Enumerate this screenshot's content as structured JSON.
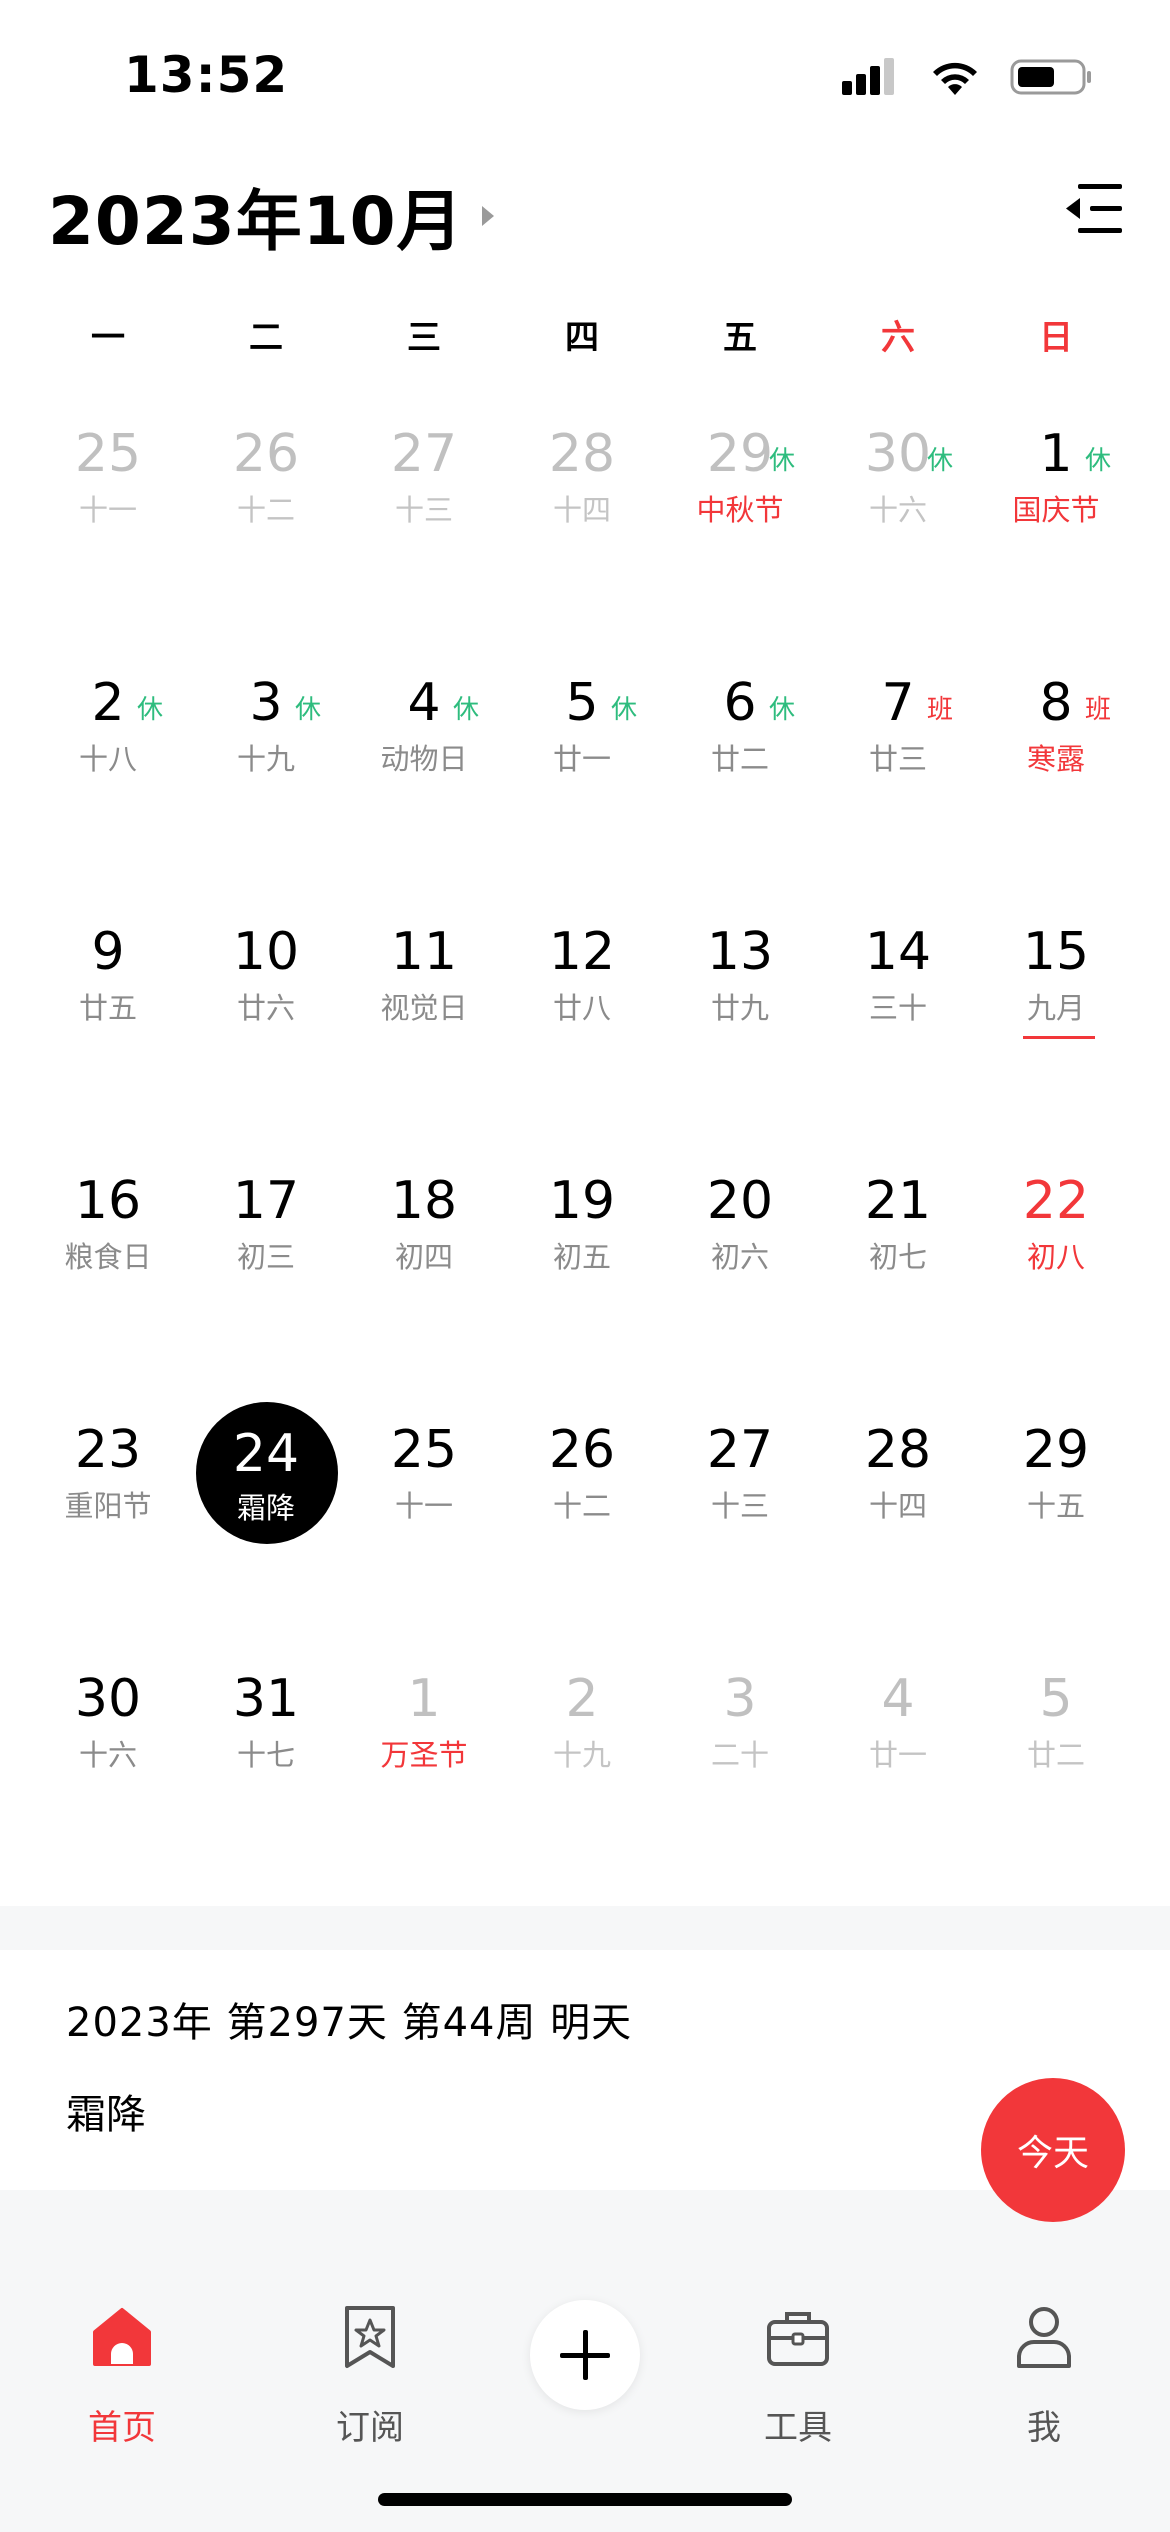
{
  "status": {
    "time": "13:52"
  },
  "header": {
    "month_title": "2023年10月"
  },
  "weekdays": [
    {
      "label": "一",
      "red": false
    },
    {
      "label": "二",
      "red": false
    },
    {
      "label": "三",
      "red": false
    },
    {
      "label": "四",
      "red": false
    },
    {
      "label": "五",
      "red": false
    },
    {
      "label": "六",
      "red": true
    },
    {
      "label": "日",
      "red": true
    }
  ],
  "weeks": [
    [
      {
        "day": "25",
        "lunar": "十一",
        "dim": true
      },
      {
        "day": "26",
        "lunar": "十二",
        "dim": true
      },
      {
        "day": "27",
        "lunar": "十三",
        "dim": true
      },
      {
        "day": "28",
        "lunar": "十四",
        "dim": true
      },
      {
        "day": "29",
        "lunar": "中秋节",
        "dim": true,
        "lunar_red": true,
        "badge": "休"
      },
      {
        "day": "30",
        "lunar": "十六",
        "dim": true,
        "badge": "休"
      },
      {
        "day": "1",
        "lunar": "国庆节",
        "lunar_red": true,
        "badge": "休"
      }
    ],
    [
      {
        "day": "2",
        "lunar": "十八",
        "badge": "休"
      },
      {
        "day": "3",
        "lunar": "十九",
        "badge": "休"
      },
      {
        "day": "4",
        "lunar": "动物日",
        "badge": "休"
      },
      {
        "day": "5",
        "lunar": "廿一",
        "badge": "休"
      },
      {
        "day": "6",
        "lunar": "廿二",
        "badge": "休"
      },
      {
        "day": "7",
        "lunar": "廿三",
        "badge": "班",
        "badge_red": true
      },
      {
        "day": "8",
        "lunar": "寒露",
        "lunar_red": true,
        "badge": "班",
        "badge_red": true
      }
    ],
    [
      {
        "day": "9",
        "lunar": "廿五"
      },
      {
        "day": "10",
        "lunar": "廿六"
      },
      {
        "day": "11",
        "lunar": "视觉日"
      },
      {
        "day": "12",
        "lunar": "廿八"
      },
      {
        "day": "13",
        "lunar": "廿九"
      },
      {
        "day": "14",
        "lunar": "三十"
      },
      {
        "day": "15",
        "lunar": "九月",
        "underline": true
      }
    ],
    [
      {
        "day": "16",
        "lunar": "粮食日"
      },
      {
        "day": "17",
        "lunar": "初三"
      },
      {
        "day": "18",
        "lunar": "初四"
      },
      {
        "day": "19",
        "lunar": "初五"
      },
      {
        "day": "20",
        "lunar": "初六"
      },
      {
        "day": "21",
        "lunar": "初七"
      },
      {
        "day": "22",
        "lunar": "初八",
        "day_red": true,
        "lunar_red": true
      }
    ],
    [
      {
        "day": "23",
        "lunar": "重阳节"
      },
      {
        "day": "24",
        "lunar": "霜降",
        "selected": true
      },
      {
        "day": "25",
        "lunar": "十一"
      },
      {
        "day": "26",
        "lunar": "十二"
      },
      {
        "day": "27",
        "lunar": "十三"
      },
      {
        "day": "28",
        "lunar": "十四"
      },
      {
        "day": "29",
        "lunar": "十五"
      }
    ],
    [
      {
        "day": "30",
        "lunar": "十六"
      },
      {
        "day": "31",
        "lunar": "十七"
      },
      {
        "day": "1",
        "lunar": "万圣节",
        "dim": true,
        "lunar_red": true
      },
      {
        "day": "2",
        "lunar": "十九",
        "dim": true
      },
      {
        "day": "3",
        "lunar": "二十",
        "dim": true
      },
      {
        "day": "4",
        "lunar": "廿一",
        "dim": true
      },
      {
        "day": "5",
        "lunar": "廿二",
        "dim": true
      }
    ]
  ],
  "info": {
    "line1": "2023年 第297天 第44周 明天",
    "line2": "霜降"
  },
  "today_button": {
    "label": "今天"
  },
  "tabs": [
    {
      "label": "首页",
      "icon": "home-icon",
      "active": true
    },
    {
      "label": "订阅",
      "icon": "bookmark-star-icon",
      "active": false
    },
    {
      "label": "工具",
      "icon": "briefcase-icon",
      "active": false
    },
    {
      "label": "我",
      "icon": "user-icon",
      "active": false
    }
  ],
  "colors": {
    "accent": "#f2373a",
    "rest": "#2ebc7e"
  }
}
